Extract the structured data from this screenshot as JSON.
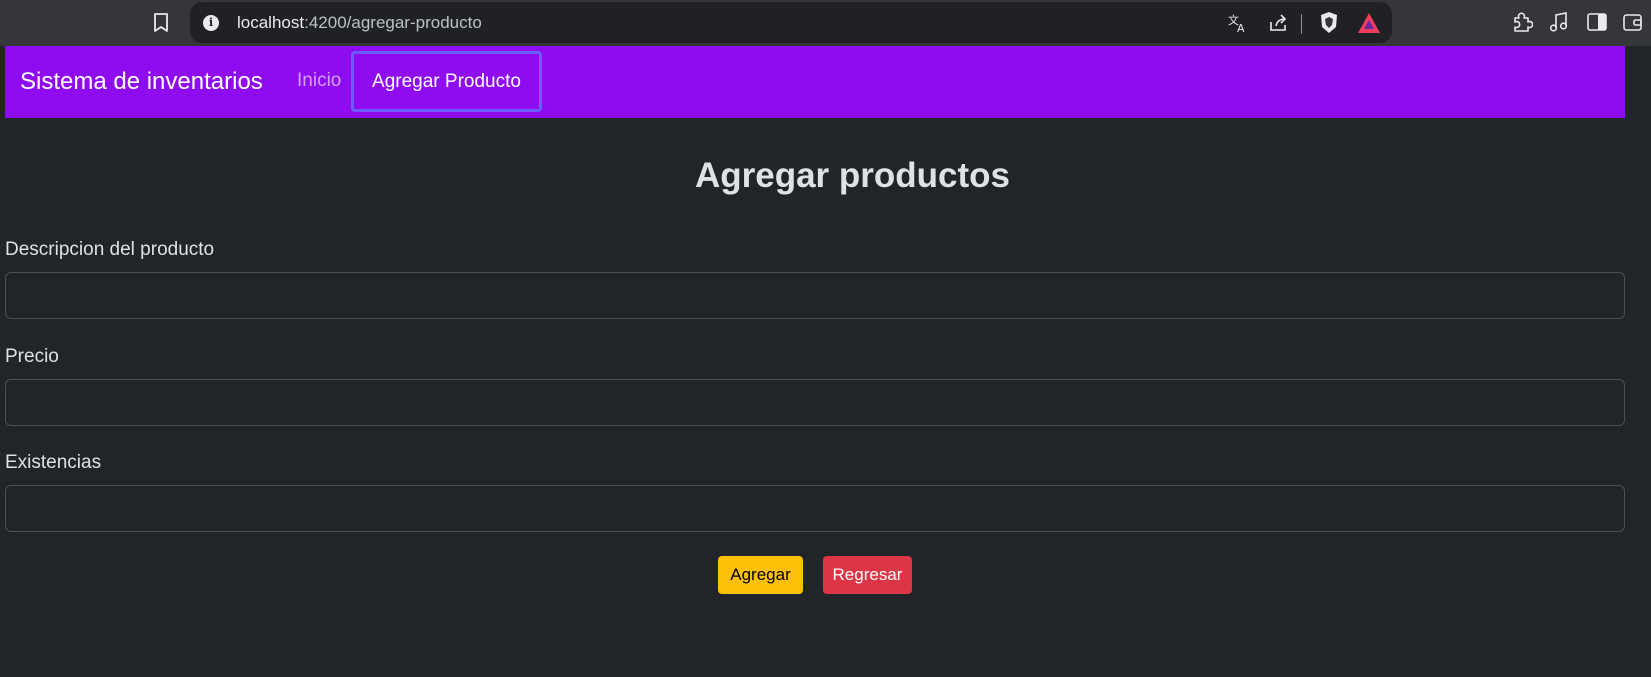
{
  "browser": {
    "url_host": "localhost",
    "url_path": ":4200/agregar-producto",
    "icons": [
      "bookmark-icon",
      "site-info-icon",
      "translate-icon",
      "share-icon",
      "brave-shields-icon",
      "brave-rewards-icon",
      "extensions-icon",
      "media-icon",
      "sidebar-icon",
      "wallet-icon"
    ]
  },
  "navbar": {
    "brand": "Sistema de inventarios",
    "links": [
      {
        "label": "Inicio",
        "active": false
      },
      {
        "label": "Agregar Producto",
        "active": true
      }
    ],
    "color": "#8f0bf0"
  },
  "form": {
    "title": "Agregar productos",
    "fields": [
      {
        "label": "Descripcion del producto",
        "value": ""
      },
      {
        "label": "Precio",
        "value": ""
      },
      {
        "label": "Existencias",
        "value": ""
      }
    ],
    "buttons": {
      "submit": "Agregar",
      "back": "Regresar"
    }
  },
  "colors": {
    "background": "#212529",
    "warning": "#ffc107",
    "danger": "#dc3545"
  }
}
